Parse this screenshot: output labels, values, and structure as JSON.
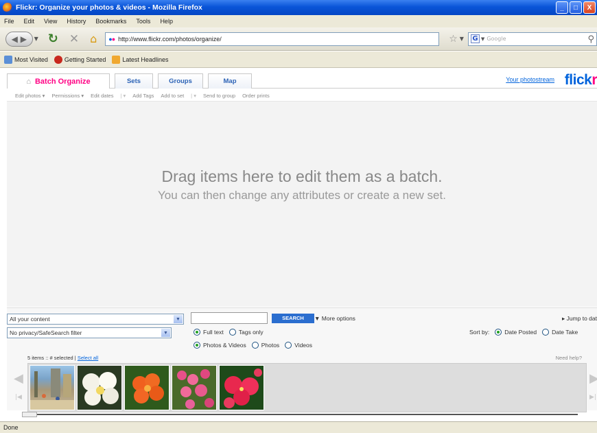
{
  "window": {
    "title": "Flickr: Organize your photos & videos - Mozilla Firefox",
    "controls": {
      "minimize": "_",
      "maximize": "□",
      "close": "X"
    }
  },
  "menu": [
    "File",
    "Edit",
    "View",
    "History",
    "Bookmarks",
    "Tools",
    "Help"
  ],
  "nav": {
    "url": "http://www.flickr.com/photos/organize/",
    "search_placeholder": "Google"
  },
  "bookmarks": [
    "Most Visited",
    "Getting Started",
    "Latest Headlines"
  ],
  "tabs": {
    "batch": "Batch Organize",
    "sets": "Sets",
    "groups": "Groups",
    "map": "Map"
  },
  "photostream_link": "Your photostream",
  "logo": {
    "part1": "flick",
    "part2": "r"
  },
  "toolbar": {
    "edit_photos": "Edit photos",
    "permissions": "Permissions",
    "edit_dates": "Edit dates",
    "add_tags": "Add Tags",
    "add_to_set": "Add to set",
    "send_to_group": "Send to group",
    "order_prints": "Order prints"
  },
  "batch": {
    "message": "Drag items here to edit them as a batch.",
    "submessage": "You can then change any attributes or create a new set."
  },
  "find": {
    "content_select": "All your content",
    "filter_select": "No privacy/SafeSearch filter",
    "search_button": "SEARCH",
    "more_options": "More options",
    "jump_to": "Jump to dat",
    "text_options": [
      "Full text",
      "Tags only"
    ],
    "text_selected": 0,
    "media_options": [
      "Photos & Videos",
      "Photos",
      "Videos"
    ],
    "media_selected": 0,
    "sort_label": "Sort by:",
    "sort_options": [
      "Date Posted",
      "Date Take"
    ],
    "sort_selected": 0,
    "items_count": "5 items :: # selected |",
    "select_all": "Select all",
    "need_help": "Need help?"
  },
  "status": "Done",
  "colors": {
    "flickr_blue": "#0063dc",
    "flickr_pink": "#ff0084",
    "xp_blue": "#0a55d8"
  }
}
